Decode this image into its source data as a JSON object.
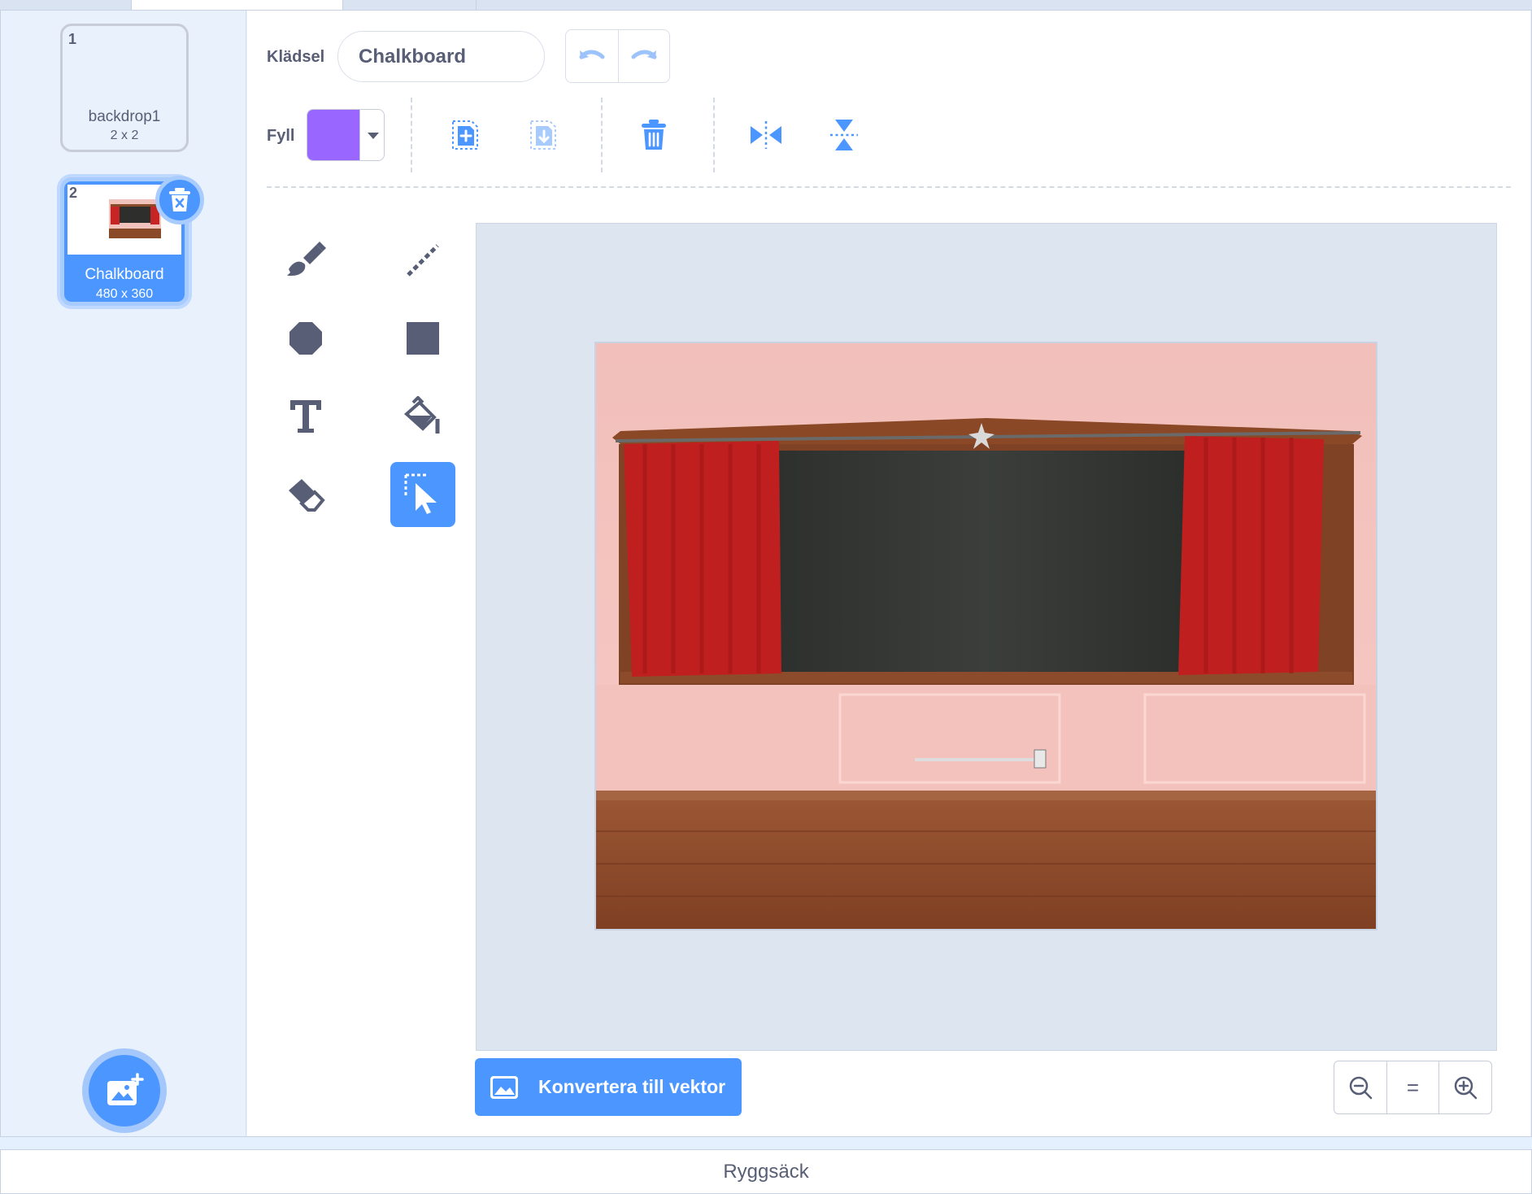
{
  "costume_list": {
    "items": [
      {
        "number": "1",
        "name": "backdrop1",
        "size": "2 x 2"
      },
      {
        "number": "2",
        "name": "Chalkboard",
        "size": "480 x 360"
      }
    ],
    "selected_index": 1
  },
  "toolbar": {
    "costume_label": "Klädsel",
    "costume_name": "Chalkboard",
    "fill_label": "Fyll",
    "fill_color": "#9966ff"
  },
  "icons": {
    "undo": "undo-icon",
    "redo": "redo-icon",
    "copy": "copy-icon",
    "paste": "paste-icon",
    "delete": "trash-icon",
    "flip_h": "flip-horizontal-icon",
    "flip_v": "flip-vertical-icon"
  },
  "tools": [
    "brush",
    "line",
    "circle",
    "rectangle",
    "text",
    "fill",
    "eraser",
    "select"
  ],
  "active_tool": "select",
  "canvas": {
    "convert_button": "Konvertera till vektor",
    "zoom_reset": "="
  },
  "backpack": {
    "label": "Ryggsäck"
  },
  "colors": {
    "accent": "#4c97ff",
    "text": "#575e75",
    "fill": "#9966ff"
  }
}
